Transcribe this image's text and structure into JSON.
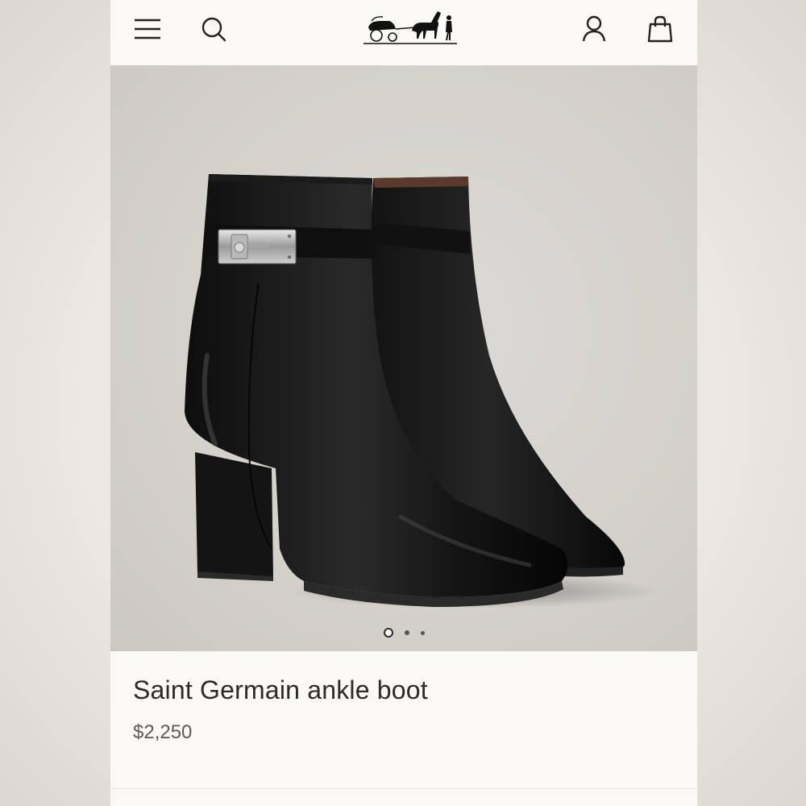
{
  "header": {
    "menu_icon": "hamburger-menu-icon",
    "search_icon": "search-icon",
    "logo_icon": "horse-carriage-logo",
    "account_icon": "user-icon",
    "bag_icon": "shopping-bag-icon"
  },
  "product": {
    "name": "Saint Germain ankle boot",
    "price": "$2,250",
    "image_alt_icon": "black-ankle-boots-image"
  },
  "carousel": {
    "total": 3,
    "active_index": 0
  },
  "colors": {
    "background": "#fbf9f5",
    "image_bg": "#d6d3cd",
    "text": "#2b2b2b"
  }
}
